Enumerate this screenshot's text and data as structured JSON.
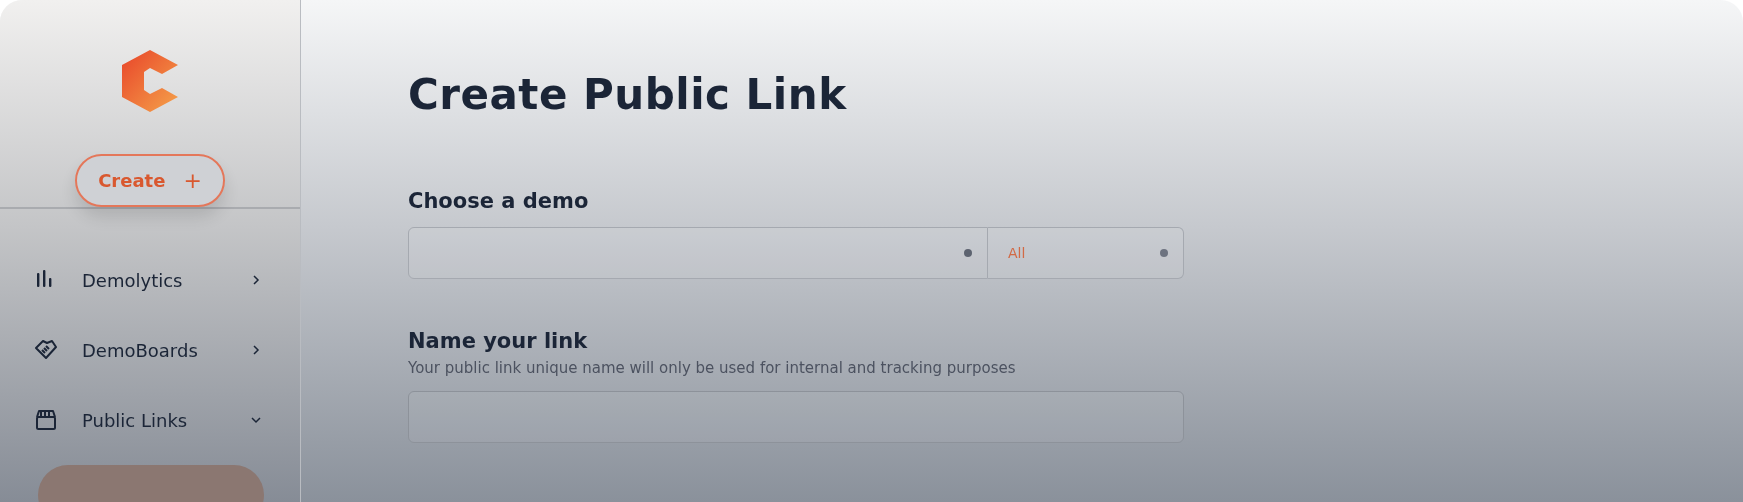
{
  "sidebar": {
    "create_button": {
      "label": "Create",
      "icon": "+"
    },
    "items": [
      {
        "label": "Demolytics",
        "expanded": false
      },
      {
        "label": "DemoBoards",
        "expanded": false
      },
      {
        "label": "Public Links",
        "expanded": true
      }
    ]
  },
  "main": {
    "title": "Create Public Link",
    "sections": [
      {
        "heading": "Choose a demo",
        "kind": "select",
        "value": "All"
      },
      {
        "heading": "Name your link",
        "kind": "text",
        "hint": "Your public link unique name will only be used for internal and tracking purposes"
      }
    ]
  }
}
